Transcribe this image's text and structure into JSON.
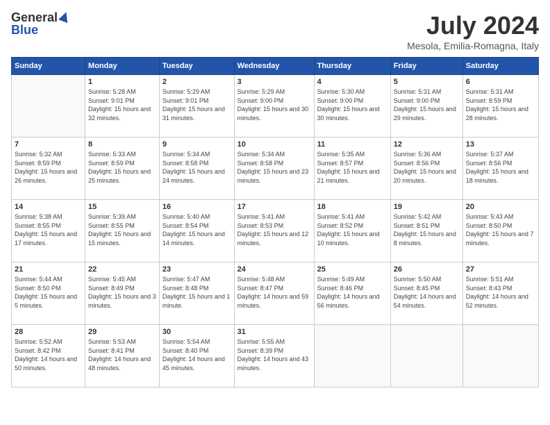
{
  "header": {
    "logo_general": "General",
    "logo_blue": "Blue",
    "month": "July 2024",
    "location": "Mesola, Emilia-Romagna, Italy"
  },
  "days_of_week": [
    "Sunday",
    "Monday",
    "Tuesday",
    "Wednesday",
    "Thursday",
    "Friday",
    "Saturday"
  ],
  "weeks": [
    [
      {
        "day": "",
        "empty": true
      },
      {
        "day": "1",
        "sunrise": "5:28 AM",
        "sunset": "9:01 PM",
        "daylight": "15 hours and 32 minutes."
      },
      {
        "day": "2",
        "sunrise": "5:29 AM",
        "sunset": "9:01 PM",
        "daylight": "15 hours and 31 minutes."
      },
      {
        "day": "3",
        "sunrise": "5:29 AM",
        "sunset": "9:00 PM",
        "daylight": "15 hours and 30 minutes."
      },
      {
        "day": "4",
        "sunrise": "5:30 AM",
        "sunset": "9:00 PM",
        "daylight": "15 hours and 30 minutes."
      },
      {
        "day": "5",
        "sunrise": "5:31 AM",
        "sunset": "9:00 PM",
        "daylight": "15 hours and 29 minutes."
      },
      {
        "day": "6",
        "sunrise": "5:31 AM",
        "sunset": "8:59 PM",
        "daylight": "15 hours and 28 minutes."
      }
    ],
    [
      {
        "day": "7",
        "sunrise": "5:32 AM",
        "sunset": "8:59 PM",
        "daylight": "15 hours and 26 minutes."
      },
      {
        "day": "8",
        "sunrise": "5:33 AM",
        "sunset": "8:59 PM",
        "daylight": "15 hours and 25 minutes."
      },
      {
        "day": "9",
        "sunrise": "5:34 AM",
        "sunset": "8:58 PM",
        "daylight": "15 hours and 24 minutes."
      },
      {
        "day": "10",
        "sunrise": "5:34 AM",
        "sunset": "8:58 PM",
        "daylight": "15 hours and 23 minutes."
      },
      {
        "day": "11",
        "sunrise": "5:35 AM",
        "sunset": "8:57 PM",
        "daylight": "15 hours and 21 minutes."
      },
      {
        "day": "12",
        "sunrise": "5:36 AM",
        "sunset": "8:56 PM",
        "daylight": "15 hours and 20 minutes."
      },
      {
        "day": "13",
        "sunrise": "5:37 AM",
        "sunset": "8:56 PM",
        "daylight": "15 hours and 18 minutes."
      }
    ],
    [
      {
        "day": "14",
        "sunrise": "5:38 AM",
        "sunset": "8:55 PM",
        "daylight": "15 hours and 17 minutes."
      },
      {
        "day": "15",
        "sunrise": "5:39 AM",
        "sunset": "8:55 PM",
        "daylight": "15 hours and 15 minutes."
      },
      {
        "day": "16",
        "sunrise": "5:40 AM",
        "sunset": "8:54 PM",
        "daylight": "15 hours and 14 minutes."
      },
      {
        "day": "17",
        "sunrise": "5:41 AM",
        "sunset": "8:53 PM",
        "daylight": "15 hours and 12 minutes."
      },
      {
        "day": "18",
        "sunrise": "5:41 AM",
        "sunset": "8:52 PM",
        "daylight": "15 hours and 10 minutes."
      },
      {
        "day": "19",
        "sunrise": "5:42 AM",
        "sunset": "8:51 PM",
        "daylight": "15 hours and 8 minutes."
      },
      {
        "day": "20",
        "sunrise": "5:43 AM",
        "sunset": "8:50 PM",
        "daylight": "15 hours and 7 minutes."
      }
    ],
    [
      {
        "day": "21",
        "sunrise": "5:44 AM",
        "sunset": "8:50 PM",
        "daylight": "15 hours and 5 minutes."
      },
      {
        "day": "22",
        "sunrise": "5:45 AM",
        "sunset": "8:49 PM",
        "daylight": "15 hours and 3 minutes."
      },
      {
        "day": "23",
        "sunrise": "5:47 AM",
        "sunset": "8:48 PM",
        "daylight": "15 hours and 1 minute."
      },
      {
        "day": "24",
        "sunrise": "5:48 AM",
        "sunset": "8:47 PM",
        "daylight": "14 hours and 59 minutes."
      },
      {
        "day": "25",
        "sunrise": "5:49 AM",
        "sunset": "8:46 PM",
        "daylight": "14 hours and 56 minutes."
      },
      {
        "day": "26",
        "sunrise": "5:50 AM",
        "sunset": "8:45 PM",
        "daylight": "14 hours and 54 minutes."
      },
      {
        "day": "27",
        "sunrise": "5:51 AM",
        "sunset": "8:43 PM",
        "daylight": "14 hours and 52 minutes."
      }
    ],
    [
      {
        "day": "28",
        "sunrise": "5:52 AM",
        "sunset": "8:42 PM",
        "daylight": "14 hours and 50 minutes."
      },
      {
        "day": "29",
        "sunrise": "5:53 AM",
        "sunset": "8:41 PM",
        "daylight": "14 hours and 48 minutes."
      },
      {
        "day": "30",
        "sunrise": "5:54 AM",
        "sunset": "8:40 PM",
        "daylight": "14 hours and 45 minutes."
      },
      {
        "day": "31",
        "sunrise": "5:55 AM",
        "sunset": "8:39 PM",
        "daylight": "14 hours and 43 minutes."
      },
      {
        "day": "",
        "empty": true
      },
      {
        "day": "",
        "empty": true
      },
      {
        "day": "",
        "empty": true
      }
    ]
  ]
}
